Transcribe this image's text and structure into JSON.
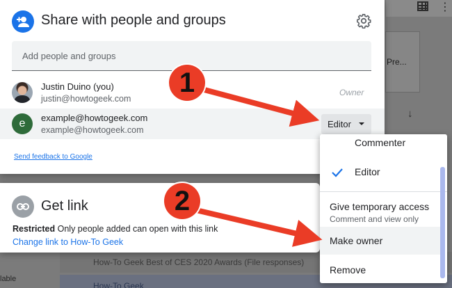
{
  "background": {
    "card_label": "Pre...",
    "row1_text": "How-To Geek Best of CES 2020 Awards (File responses)",
    "row2_text": "How-To Geek",
    "left_text": "lable"
  },
  "share_dialog": {
    "title": "Share with people and groups",
    "add_placeholder": "Add people and groups",
    "people": [
      {
        "name": "Justin Duino (you)",
        "email": "justin@howtogeek.com",
        "role": "Owner"
      },
      {
        "name": "example@howtogeek.com",
        "email": "example@howtogeek.com",
        "avatar_letter": "e",
        "role": "Editor"
      }
    ],
    "feedback_link": "Send feedback to Google"
  },
  "get_link": {
    "title": "Get link",
    "restricted_label": "Restricted",
    "description": "Only people added can open with this link",
    "change_link": "Change link to How-To Geek"
  },
  "role_menu": {
    "items": [
      {
        "label": "Commenter"
      },
      {
        "label": "Editor",
        "selected": true
      },
      {
        "label": "Give temporary access",
        "sublabel": "Comment and view only"
      },
      {
        "label": "Make owner",
        "highlighted": true
      },
      {
        "label": "Remove"
      }
    ]
  },
  "annotations": {
    "step1": "1",
    "step2": "2"
  },
  "colors": {
    "accent": "#1a73e8",
    "annotation": "#ea3c26",
    "avatar_green": "#2e6b3a"
  }
}
